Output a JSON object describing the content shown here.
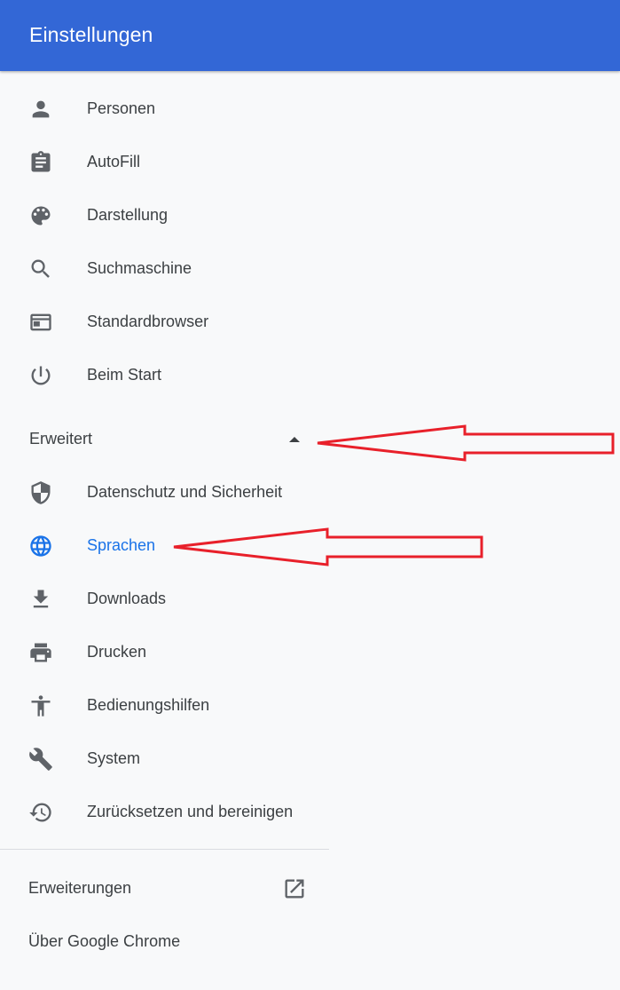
{
  "header": {
    "title": "Einstellungen"
  },
  "menu": {
    "items": [
      {
        "label": "Personen",
        "icon": "person-icon"
      },
      {
        "label": "AutoFill",
        "icon": "clipboard-icon"
      },
      {
        "label": "Darstellung",
        "icon": "palette-icon"
      },
      {
        "label": "Suchmaschine",
        "icon": "search-icon"
      },
      {
        "label": "Standardbrowser",
        "icon": "browser-window-icon"
      },
      {
        "label": "Beim Start",
        "icon": "power-icon"
      }
    ]
  },
  "advanced": {
    "label": "Erweitert",
    "expanded": true,
    "items": [
      {
        "label": "Datenschutz und Sicherheit",
        "icon": "shield-icon"
      },
      {
        "label": "Sprachen",
        "icon": "globe-icon",
        "active": true
      },
      {
        "label": "Downloads",
        "icon": "download-icon"
      },
      {
        "label": "Drucken",
        "icon": "printer-icon"
      },
      {
        "label": "Bedienungshilfen",
        "icon": "accessibility-icon"
      },
      {
        "label": "System",
        "icon": "wrench-icon"
      },
      {
        "label": "Zurücksetzen und bereinigen",
        "icon": "restore-icon"
      }
    ]
  },
  "footer": {
    "extensions_label": "Erweiterungen",
    "extensions_icon": "open-in-new-icon",
    "about_label": "Über Google Chrome"
  },
  "colors": {
    "header_bg": "#3367d6",
    "active": "#1a73e8",
    "text": "#3c4043",
    "icon": "#5f6368",
    "annotation_arrow": "#e8202a"
  }
}
